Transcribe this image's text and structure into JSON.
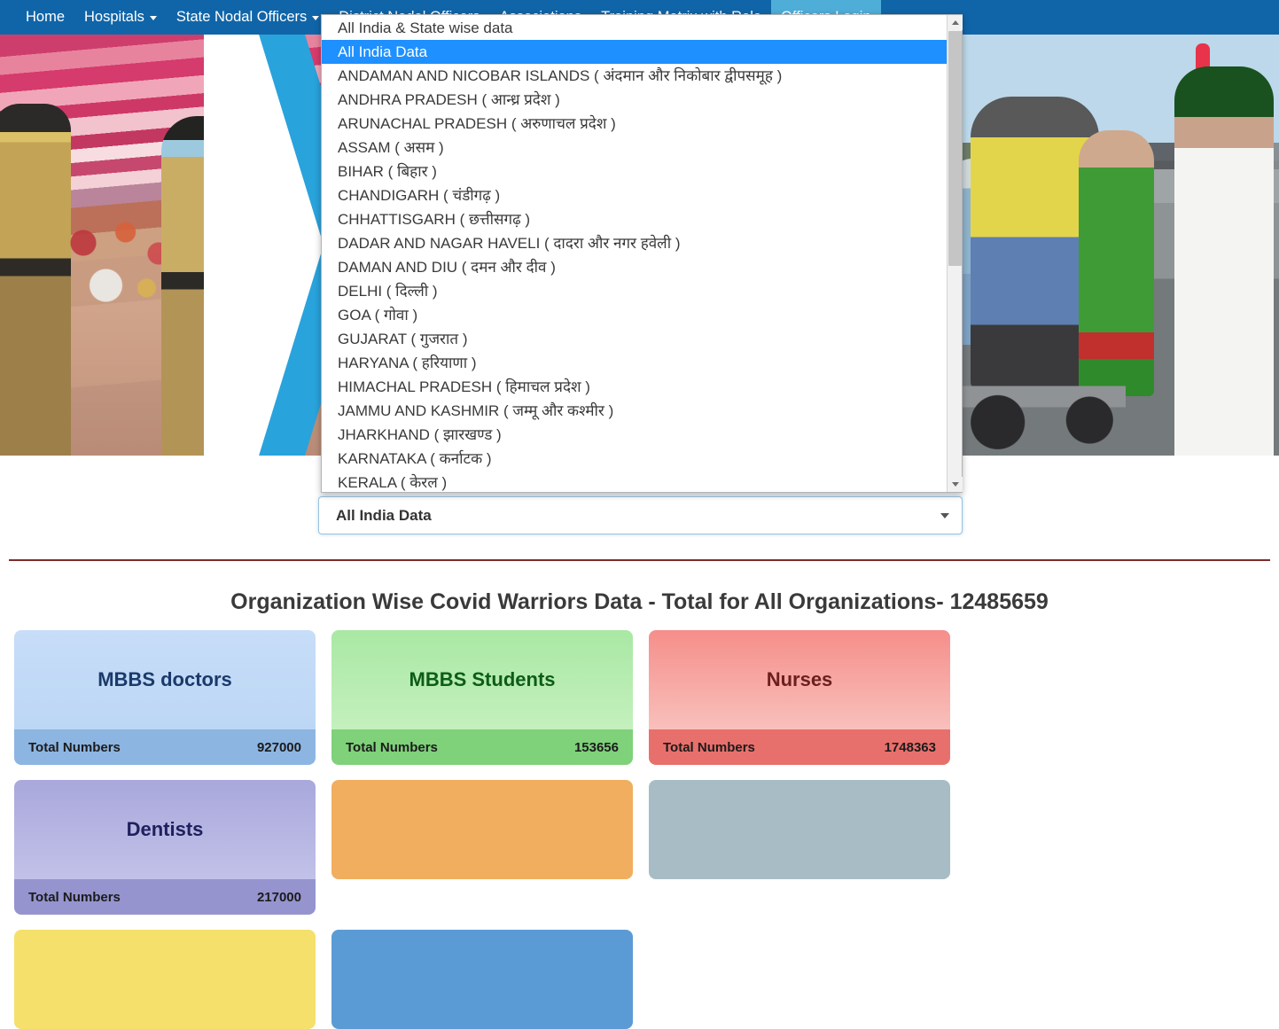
{
  "navbar": {
    "brand_color": "#1065a8",
    "active_color": "#4eaed8",
    "items": [
      {
        "label": "Home",
        "has_caret": false,
        "active": false
      },
      {
        "label": "Hospitals",
        "has_caret": true,
        "active": false
      },
      {
        "label": "State Nodal Officers",
        "has_caret": true,
        "active": false
      },
      {
        "label": "District Nodal Officers",
        "has_caret": false,
        "active": false
      },
      {
        "label": "Associations",
        "has_caret": false,
        "active": false
      },
      {
        "label": "Training Matrix with Role",
        "has_caret": false,
        "active": false
      },
      {
        "label": "Officers Login",
        "has_caret": false,
        "active": true
      }
    ]
  },
  "state_select": {
    "selected_value": "All India Data",
    "placeholder": "All India & State wise data",
    "expanded": true,
    "highlighted_index": 1,
    "options": [
      "All India & State wise data",
      "All India Data",
      "ANDAMAN AND NICOBAR ISLANDS ( अंदमान और निकोबार द्वीपसमूह )",
      "ANDHRA PRADESH ( आन्ध्र प्रदेश )",
      "ARUNACHAL PRADESH ( अरुणाचल प्रदेश )",
      "ASSAM ( असम )",
      "BIHAR ( बिहार )",
      "CHANDIGARH ( चंडीगढ़ )",
      "CHHATTISGARH ( छत्तीसगढ़ )",
      "DADAR AND NAGAR HAVELI ( दादरा और नगर हवेली )",
      "DAMAN AND DIU ( दमन और दीव )",
      "DELHI ( दिल्ली )",
      "GOA ( गोवा )",
      "GUJARAT ( गुजरात )",
      "HARYANA ( हरियाणा )",
      "HIMACHAL PRADESH ( हिमाचल प्रदेश )",
      "JAMMU AND KASHMIR ( जम्मू और कश्मीर )",
      "JHARKHAND ( झारखण्ड )",
      "KARNATAKA ( कर्नाटक )",
      "KERALA ( केरल )"
    ]
  },
  "section": {
    "title": "Organization Wise Covid Warriors Data - Total for All Organizations- 12485659",
    "divider_color": "#7d2b2b"
  },
  "cards": {
    "total_label": "Total Numbers",
    "items": [
      {
        "title": "MBBS doctors",
        "total_label": "Total Numbers",
        "value": "927000",
        "head_top": "#c7ddf8",
        "head_bottom": "#bcd7f5",
        "foot": "#8db5e2",
        "title_color": "#1b3a6b"
      },
      {
        "title": "MBBS Students",
        "total_label": "Total Numbers",
        "value": "153656",
        "head_top": "#a9e8a4",
        "head_bottom": "#c4f0bd",
        "foot": "#7fd17a",
        "title_color": "#0d5c18"
      },
      {
        "title": "Nurses",
        "total_label": "Total Numbers",
        "value": "1748363",
        "head_top": "#f58e8a",
        "head_bottom": "#f9c0bc",
        "foot": "#e8706c",
        "title_color": "#6b1f1f"
      },
      {
        "title": "Dentists",
        "total_label": "Total Numbers",
        "value": "217000",
        "head_top": "#a9a8dc",
        "head_bottom": "#c2c1e8",
        "foot": "#9594cf",
        "title_color": "#20205e"
      }
    ],
    "next_row_colors": [
      "#f0ae5e",
      "#a8bcc6",
      "#f4e06a",
      "#5b9bd5"
    ]
  }
}
